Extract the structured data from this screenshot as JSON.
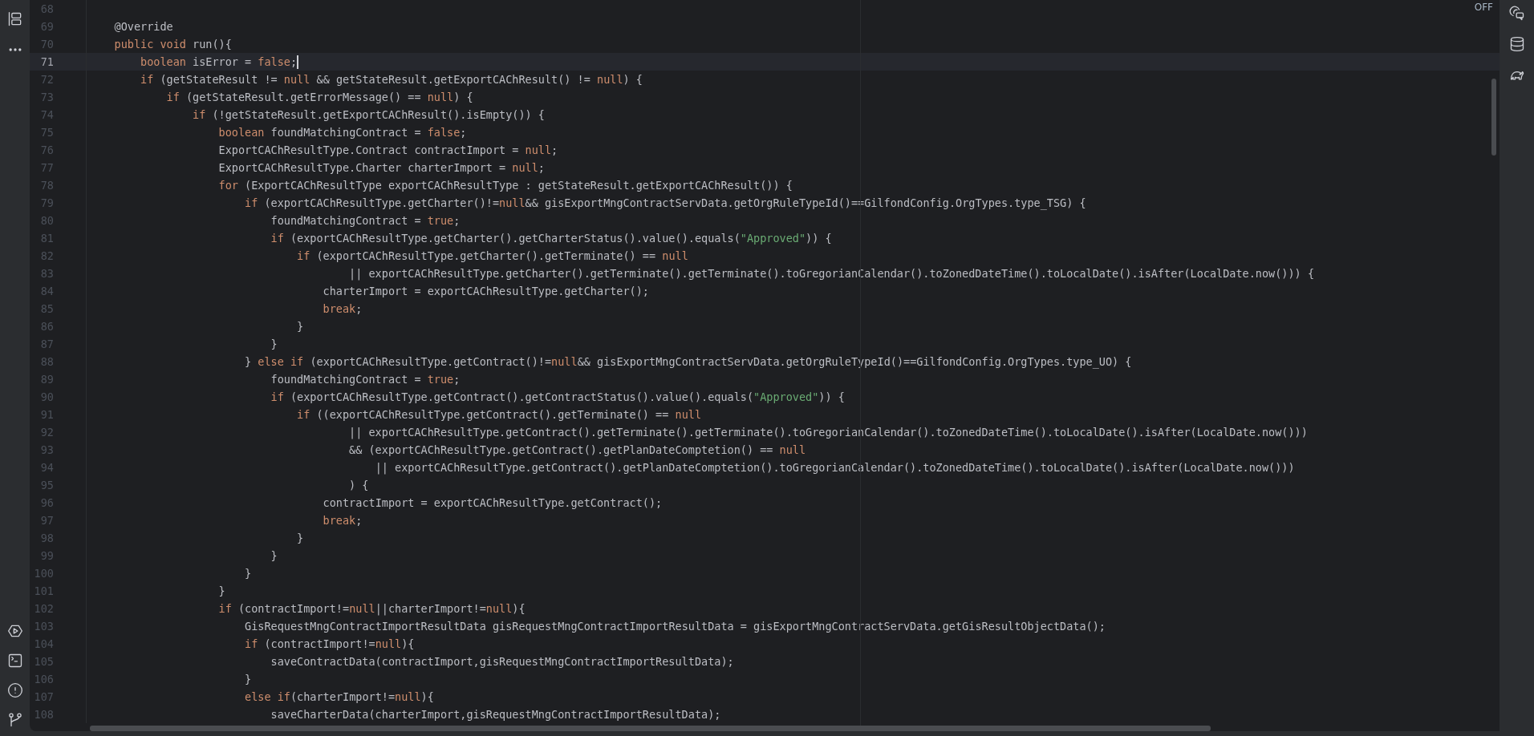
{
  "editor": {
    "badge": "OFF",
    "lines": [
      {
        "number": "68",
        "current": false
      },
      {
        "number": "69",
        "current": false,
        "tokens": [
          {
            "kind": "plain",
            "text": "    @Override"
          }
        ]
      },
      {
        "number": "70",
        "current": false,
        "tokens": [
          {
            "kind": "keyword",
            "text": "    public void "
          },
          {
            "kind": "plain",
            "text": "run(){"
          }
        ]
      },
      {
        "number": "71",
        "current": true,
        "tokens": [
          {
            "kind": "keyword",
            "text": "        boolean "
          },
          {
            "kind": "plain",
            "text": "isError = "
          },
          {
            "kind": "keyword",
            "text": "false"
          },
          {
            "kind": "plain",
            "text": ";"
          }
        ]
      },
      {
        "number": "72",
        "current": false,
        "tokens": [
          {
            "kind": "keyword",
            "text": "        if "
          },
          {
            "kind": "plain",
            "text": "(getStateResult != "
          },
          {
            "kind": "keyword",
            "text": "null"
          },
          {
            "kind": "plain",
            "text": " && getStateResult.getExportCAChResult() != "
          },
          {
            "kind": "keyword",
            "text": "null"
          },
          {
            "kind": "plain",
            "text": ") {"
          }
        ]
      },
      {
        "number": "73",
        "current": false,
        "tokens": [
          {
            "kind": "keyword",
            "text": "            if "
          },
          {
            "kind": "plain",
            "text": "(getStateResult.getErrorMessage() == "
          },
          {
            "kind": "keyword",
            "text": "null"
          },
          {
            "kind": "plain",
            "text": ") {"
          }
        ]
      },
      {
        "number": "74",
        "current": false,
        "tokens": [
          {
            "kind": "keyword",
            "text": "                if "
          },
          {
            "kind": "plain",
            "text": "(!getStateResult.getExportCAChResult().isEmpty()) {"
          }
        ]
      },
      {
        "number": "75",
        "current": false,
        "tokens": [
          {
            "kind": "keyword",
            "text": "                    boolean "
          },
          {
            "kind": "plain",
            "text": "foundMatchingContract = "
          },
          {
            "kind": "keyword",
            "text": "false"
          },
          {
            "kind": "plain",
            "text": ";"
          }
        ]
      },
      {
        "number": "76",
        "current": false,
        "tokens": [
          {
            "kind": "plain",
            "text": "                    ExportCAChResultType.Contract contractImport = "
          },
          {
            "kind": "keyword",
            "text": "null"
          },
          {
            "kind": "plain",
            "text": ";"
          }
        ]
      },
      {
        "number": "77",
        "current": false,
        "tokens": [
          {
            "kind": "plain",
            "text": "                    ExportCAChResultType.Charter charterImport = "
          },
          {
            "kind": "keyword",
            "text": "null"
          },
          {
            "kind": "plain",
            "text": ";"
          }
        ]
      },
      {
        "number": "78",
        "current": false,
        "tokens": [
          {
            "kind": "keyword",
            "text": "                    for "
          },
          {
            "kind": "plain",
            "text": "(ExportCAChResultType exportCAChResultType : getStateResult.getExportCAChResult()) {"
          }
        ]
      },
      {
        "number": "79",
        "current": false,
        "tokens": [
          {
            "kind": "keyword",
            "text": "                        if "
          },
          {
            "kind": "plain",
            "text": "(exportCAChResultType.getCharter()!="
          },
          {
            "kind": "keyword",
            "text": "null"
          },
          {
            "kind": "plain",
            "text": "&& gisExportMngContractServData.getOrgRuleTypeId()==GilfondConfig.OrgTypes.type_TSG) {"
          }
        ]
      },
      {
        "number": "80",
        "current": false,
        "tokens": [
          {
            "kind": "plain",
            "text": "                            foundMatchingContract = "
          },
          {
            "kind": "keyword",
            "text": "true"
          },
          {
            "kind": "plain",
            "text": ";"
          }
        ]
      },
      {
        "number": "81",
        "current": false,
        "tokens": [
          {
            "kind": "keyword",
            "text": "                            if "
          },
          {
            "kind": "plain",
            "text": "(exportCAChResultType.getCharter().getCharterStatus().value().equals("
          },
          {
            "kind": "string",
            "text": "\"Approved\""
          },
          {
            "kind": "plain",
            "text": ")) {"
          }
        ]
      },
      {
        "number": "82",
        "current": false,
        "tokens": [
          {
            "kind": "keyword",
            "text": "                                if "
          },
          {
            "kind": "plain",
            "text": "(exportCAChResultType.getCharter().getTerminate() == "
          },
          {
            "kind": "keyword",
            "text": "null"
          }
        ]
      },
      {
        "number": "83",
        "current": false,
        "tokens": [
          {
            "kind": "plain",
            "text": "                                        || exportCAChResultType.getCharter().getTerminate().getTerminate().toGregorianCalendar().toZonedDateTime().toLocalDate().isAfter(LocalDate.now())) {"
          }
        ]
      },
      {
        "number": "84",
        "current": false,
        "tokens": [
          {
            "kind": "plain",
            "text": "                                    charterImport = exportCAChResultType.getCharter();"
          }
        ]
      },
      {
        "number": "85",
        "current": false,
        "tokens": [
          {
            "kind": "keyword",
            "text": "                                    break"
          },
          {
            "kind": "plain",
            "text": ";"
          }
        ]
      },
      {
        "number": "86",
        "current": false,
        "tokens": [
          {
            "kind": "plain",
            "text": "                                }"
          }
        ]
      },
      {
        "number": "87",
        "current": false,
        "tokens": [
          {
            "kind": "plain",
            "text": "                            }"
          }
        ]
      },
      {
        "number": "88",
        "current": false,
        "tokens": [
          {
            "kind": "plain",
            "text": "                        } "
          },
          {
            "kind": "keyword",
            "text": "else if "
          },
          {
            "kind": "plain",
            "text": "(exportCAChResultType.getContract()!="
          },
          {
            "kind": "keyword",
            "text": "null"
          },
          {
            "kind": "plain",
            "text": "&& gisExportMngContractServData.getOrgRuleTypeId()==GilfondConfig.OrgTypes.type_UO) {"
          }
        ]
      },
      {
        "number": "89",
        "current": false,
        "tokens": [
          {
            "kind": "plain",
            "text": "                            foundMatchingContract = "
          },
          {
            "kind": "keyword",
            "text": "true"
          },
          {
            "kind": "plain",
            "text": ";"
          }
        ]
      },
      {
        "number": "90",
        "current": false,
        "tokens": [
          {
            "kind": "keyword",
            "text": "                            if "
          },
          {
            "kind": "plain",
            "text": "(exportCAChResultType.getContract().getContractStatus().value().equals("
          },
          {
            "kind": "string",
            "text": "\"Approved\""
          },
          {
            "kind": "plain",
            "text": ")) {"
          }
        ]
      },
      {
        "number": "91",
        "current": false,
        "tokens": [
          {
            "kind": "keyword",
            "text": "                                if "
          },
          {
            "kind": "plain",
            "text": "((exportCAChResultType.getContract().getTerminate() == "
          },
          {
            "kind": "keyword",
            "text": "null"
          }
        ]
      },
      {
        "number": "92",
        "current": false,
        "tokens": [
          {
            "kind": "plain",
            "text": "                                        || exportCAChResultType.getContract().getTerminate().getTerminate().toGregorianCalendar().toZonedDateTime().toLocalDate().isAfter(LocalDate.now()))"
          }
        ]
      },
      {
        "number": "93",
        "current": false,
        "tokens": [
          {
            "kind": "plain",
            "text": "                                        && (exportCAChResultType.getContract().getPlanDateComptetion() == "
          },
          {
            "kind": "keyword",
            "text": "null"
          }
        ]
      },
      {
        "number": "94",
        "current": false,
        "tokens": [
          {
            "kind": "plain",
            "text": "                                            || exportCAChResultType.getContract().getPlanDateComptetion().toGregorianCalendar().toZonedDateTime().toLocalDate().isAfter(LocalDate.now()))"
          }
        ]
      },
      {
        "number": "95",
        "current": false,
        "tokens": [
          {
            "kind": "plain",
            "text": "                                        ) {"
          }
        ]
      },
      {
        "number": "96",
        "current": false,
        "tokens": [
          {
            "kind": "plain",
            "text": "                                    contractImport = exportCAChResultType.getContract();"
          }
        ]
      },
      {
        "number": "97",
        "current": false,
        "tokens": [
          {
            "kind": "keyword",
            "text": "                                    break"
          },
          {
            "kind": "plain",
            "text": ";"
          }
        ]
      },
      {
        "number": "98",
        "current": false,
        "tokens": [
          {
            "kind": "plain",
            "text": "                                }"
          }
        ]
      },
      {
        "number": "99",
        "current": false,
        "tokens": [
          {
            "kind": "plain",
            "text": "                            }"
          }
        ]
      },
      {
        "number": "100",
        "current": false,
        "tokens": [
          {
            "kind": "plain",
            "text": "                        }"
          }
        ]
      },
      {
        "number": "101",
        "current": false,
        "tokens": [
          {
            "kind": "plain",
            "text": "                    }"
          }
        ]
      },
      {
        "number": "102",
        "current": false,
        "tokens": [
          {
            "kind": "keyword",
            "text": "                    if "
          },
          {
            "kind": "plain",
            "text": "(contractImport!="
          },
          {
            "kind": "keyword",
            "text": "null"
          },
          {
            "kind": "plain",
            "text": "||charterImport!="
          },
          {
            "kind": "keyword",
            "text": "null"
          },
          {
            "kind": "plain",
            "text": "){"
          }
        ]
      },
      {
        "number": "103",
        "current": false,
        "tokens": [
          {
            "kind": "plain",
            "text": "                        GisRequestMngContractImportResultData gisRequestMngContractImportResultData = gisExportMngContractServData.getGisResultObjectData();"
          }
        ]
      },
      {
        "number": "104",
        "current": false,
        "tokens": [
          {
            "kind": "keyword",
            "text": "                        if "
          },
          {
            "kind": "plain",
            "text": "(contractImport!="
          },
          {
            "kind": "keyword",
            "text": "null"
          },
          {
            "kind": "plain",
            "text": "){"
          }
        ]
      },
      {
        "number": "105",
        "current": false,
        "tokens": [
          {
            "kind": "plain",
            "text": "                            saveContractData(contractImport,gisRequestMngContractImportResultData);"
          }
        ]
      },
      {
        "number": "106",
        "current": false,
        "tokens": [
          {
            "kind": "plain",
            "text": "                        }"
          }
        ]
      },
      {
        "number": "107",
        "current": false,
        "tokens": [
          {
            "kind": "keyword",
            "text": "                        else if"
          },
          {
            "kind": "plain",
            "text": "(charterImport!="
          },
          {
            "kind": "keyword",
            "text": "null"
          },
          {
            "kind": "plain",
            "text": "){"
          }
        ]
      },
      {
        "number": "108",
        "current": false,
        "tokens": [
          {
            "kind": "plain",
            "text": "                            saveCharterData(charterImport,gisRequestMngContractImportResultData);"
          }
        ]
      }
    ]
  }
}
